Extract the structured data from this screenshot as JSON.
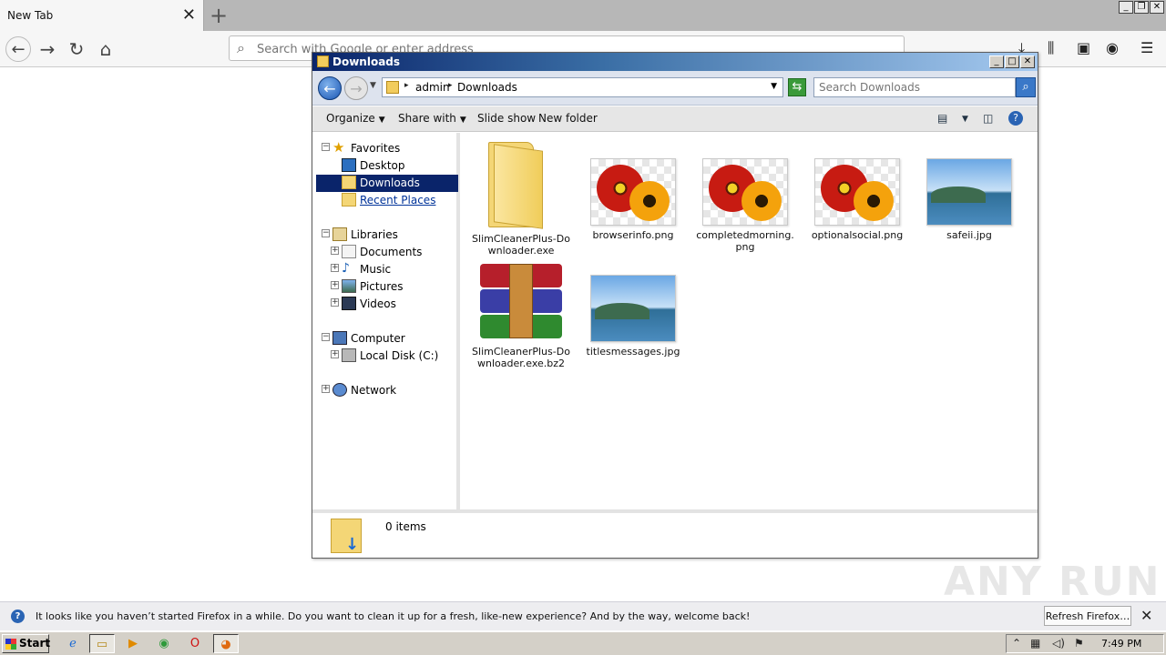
{
  "firefox": {
    "tab_title": "New Tab",
    "tab_close": "✕",
    "new_tab": "+",
    "url_placeholder": "Search with Google or enter address",
    "notification": {
      "message": "It looks like you haven’t started Firefox in a while. Do you want to clean it up for a fresh, like-new experience? And by the way, welcome back!",
      "button": "Refresh Firefox…",
      "close": "✕"
    }
  },
  "explorer": {
    "title": "Downloads",
    "breadcrumb": [
      "admin",
      "Downloads"
    ],
    "search_placeholder": "Search Downloads",
    "commands": {
      "organize": "Organize",
      "share_with": "Share with",
      "slide_show": "Slide show",
      "new_folder": "New folder"
    },
    "nav": {
      "favorites": "Favorites",
      "desktop": "Desktop",
      "downloads": "Downloads",
      "recent_places": "Recent Places",
      "libraries": "Libraries",
      "documents": "Documents",
      "music": "Music",
      "pictures": "Pictures",
      "videos": "Videos",
      "computer": "Computer",
      "local_disk": "Local Disk (C:)",
      "network": "Network"
    },
    "files": [
      {
        "name": "SlimCleanerPlus-Downloader.exe",
        "type": "folder-exe"
      },
      {
        "name": "browserinfo.png",
        "type": "flower"
      },
      {
        "name": "completedmorning.png",
        "type": "flower"
      },
      {
        "name": "optionalsocial.png",
        "type": "flower"
      },
      {
        "name": "safeii.jpg",
        "type": "landscape"
      },
      {
        "name": "SlimCleanerPlus-Downloader.exe.bz2",
        "type": "archive"
      },
      {
        "name": "titlesmessages.jpg",
        "type": "landscape"
      }
    ],
    "status": "0 items"
  },
  "taskbar": {
    "start_label": "Start",
    "clock": "7:49 PM"
  },
  "watermark": "ANY RUN"
}
